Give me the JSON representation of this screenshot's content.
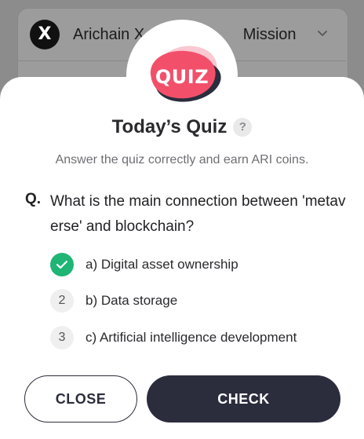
{
  "background_app": {
    "title_left": "Arichain X",
    "title_right": "Mission",
    "social_icon": "x-logo-icon",
    "dropdown_icon": "chevron-down-icon"
  },
  "modal": {
    "badge_text": "QUIZ",
    "title": "Today’s Quiz",
    "help_icon": "?",
    "subtitle": "Answer the quiz correctly and earn ARI coins.",
    "question_prefix": "Q.",
    "question": "What is the main connection between 'metaverse' and blockchain?",
    "options": [
      {
        "marker": "",
        "label": "a) Digital asset ownership",
        "selected": true
      },
      {
        "marker": "2",
        "label": "b) Data storage",
        "selected": false
      },
      {
        "marker": "3",
        "label": "c) Artificial intelligence development",
        "selected": false
      }
    ],
    "buttons": {
      "close": "CLOSE",
      "check": "CHECK"
    }
  },
  "colors": {
    "accent_dark": "#2b2d3d",
    "quiz_badge": "#f2506a",
    "correct_green": "#1fb574"
  }
}
